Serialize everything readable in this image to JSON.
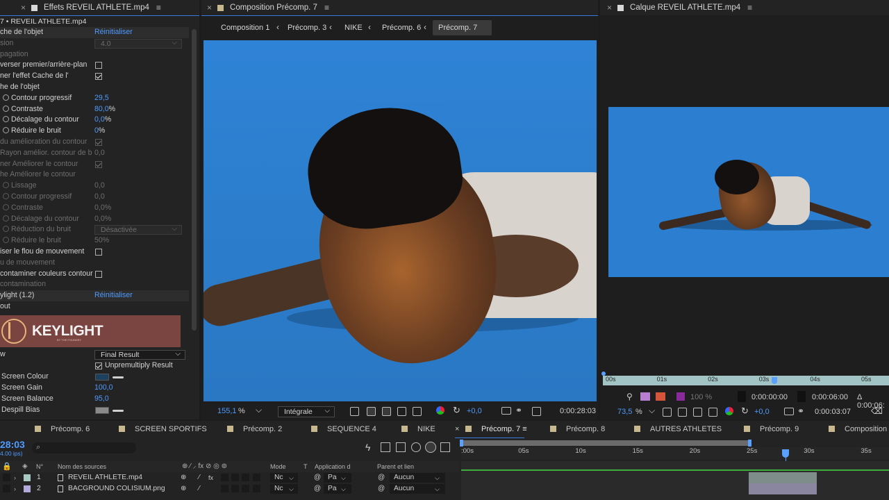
{
  "effects_panel": {
    "tab_title": "Effets  REVEIL ATHLETE.mp4",
    "subheader": "7 • REVEIL ATHLETE.mp4",
    "rows": [
      {
        "label": "che de l'objet",
        "value": "Réinitialiser",
        "type": "header"
      },
      {
        "label": "sion",
        "value": "4.0",
        "type": "dropdown-dim"
      },
      {
        "label": "pagation",
        "type": "dim"
      },
      {
        "label": "verser premier/arrière-plan",
        "type": "check"
      },
      {
        "label": "ner l'effet Cache de l'",
        "type": "check-on"
      },
      {
        "label": "he de l'objet",
        "type": "plain"
      },
      {
        "label": "Contour progressif",
        "value": "29,5",
        "type": "stop"
      },
      {
        "label": "Contraste",
        "value": "80,0",
        "unit": "%",
        "type": "stop"
      },
      {
        "label": "Décalage du contour",
        "value": "0,0",
        "unit": "%",
        "type": "stop"
      },
      {
        "label": "Réduire le bruit",
        "value": "0",
        "unit": "%",
        "type": "stop"
      },
      {
        "label": "du amélioration du contour",
        "type": "check-on-dim"
      },
      {
        "label": "Rayon amélior. contour de b",
        "value": "0,0",
        "type": "dim-val"
      },
      {
        "label": "ner Améliorer le contour",
        "type": "check-on-dim"
      },
      {
        "label": "he Améliorer le contour",
        "type": "dim"
      },
      {
        "label": "Lissage",
        "value": "0,0",
        "type": "stop-dim"
      },
      {
        "label": "Contour progressif",
        "value": "0,0",
        "type": "stop-dim"
      },
      {
        "label": "Contraste",
        "value": "0,0%",
        "type": "stop-dim"
      },
      {
        "label": "Décalage du contour",
        "value": "0,0%",
        "type": "stop-dim"
      },
      {
        "label": "Réduction du bruit",
        "value": "Désactivée",
        "type": "dropdown-dim-stop"
      },
      {
        "label": "Réduire le bruit",
        "value": "50%",
        "type": "stop-dim"
      },
      {
        "label": "iser le flou de mouvement",
        "type": "check"
      },
      {
        "label": "u de mouvement",
        "type": "dim"
      },
      {
        "label": "contaminer couleurs contour",
        "type": "check"
      },
      {
        "label": "contamination",
        "type": "dim"
      },
      {
        "label": "ylight (1.2)",
        "value": "Réinitialiser",
        "type": "header"
      },
      {
        "label": "out",
        "type": "plain"
      }
    ],
    "keylight_logo_text": "KEYLIGHT",
    "keylight_logo_sub": "BY THE FOUNDRY",
    "view_label": "w",
    "view_value": "Final Result",
    "unpremultiply_label": "Unpremultiply Result",
    "screen_colour_label": "Screen Colour",
    "screen_gain_label": "Screen Gain",
    "screen_gain_value": "100,0",
    "screen_balance_label": "Screen Balance",
    "screen_balance_value": "95,0",
    "despill_bias_label": "Despill Bias"
  },
  "composition_panel": {
    "tab_title": "Composition  Précomp. 7",
    "breadcrumbs": [
      "Composition 1",
      "Précomp. 3",
      "NIKE",
      "Précomp. 6",
      "Précomp. 7"
    ],
    "zoom": "155,1",
    "zoom_unit": "%",
    "resolution": "Intégrale",
    "exposure": "+0,0",
    "timecode": "0:00:28:03"
  },
  "layer_panel": {
    "tab_title": "Calque  REVEIL ATHLETE.mp4",
    "ruler_labels": [
      "00s",
      "01s",
      "02s",
      "03s",
      "04s",
      "05s"
    ],
    "opacity": "100 %",
    "in_point": "0:00:00:00",
    "out_point": "0:00:06:00",
    "duration": "Δ 0:00:06:",
    "zoom": "73,5",
    "zoom_unit": "%",
    "exposure": "+0,0",
    "timecode": "0:00:03:07"
  },
  "timeline": {
    "tabs": [
      {
        "label": "Précomp. 6",
        "color": "#c8b890"
      },
      {
        "label": "SCREEN SPORTIFS",
        "color": "#c8b890"
      },
      {
        "label": "Précomp. 2",
        "color": "#c8b890"
      },
      {
        "label": "SEQUENCE 4",
        "color": "#c8b890"
      },
      {
        "label": "NIKE",
        "color": "#c8b890"
      },
      {
        "label": "Précomp. 7",
        "color": "#c8b890",
        "active": true
      },
      {
        "label": "Précomp. 8",
        "color": "#c8b890"
      },
      {
        "label": "AUTRES ATHLETES",
        "color": "#c8b890"
      },
      {
        "label": "Précomp. 9",
        "color": "#c8b890"
      },
      {
        "label": "Composition 1",
        "color": "#c8b890"
      }
    ],
    "current_time": "28:03",
    "fps": "4.00 ips)",
    "search_placeholder": "",
    "columns": {
      "num": "N°",
      "source": "Nom des sources",
      "mode": "Mode",
      "t": "T",
      "track_matte": "Application d",
      "parent": "Parent et lien"
    },
    "ruler_labels": [
      ":00s",
      "05s",
      "10s",
      "15s",
      "20s",
      "25s",
      "30s",
      "35s"
    ],
    "layers": [
      {
        "num": "1",
        "name": "REVEIL ATHLETE.mp4",
        "label_color": "#a9c9c2",
        "mode": "Nc",
        "matte": "Pa",
        "parent": "Aucun"
      },
      {
        "num": "2",
        "name": "BACGROUND COLISIUM.png",
        "label_color": "#b2aad8",
        "mode": "Nc",
        "matte": "Pa",
        "parent": "Aucun"
      }
    ]
  },
  "colors": {
    "accent": "#4f9bff",
    "chroma_blue": "#2c7fd0"
  }
}
